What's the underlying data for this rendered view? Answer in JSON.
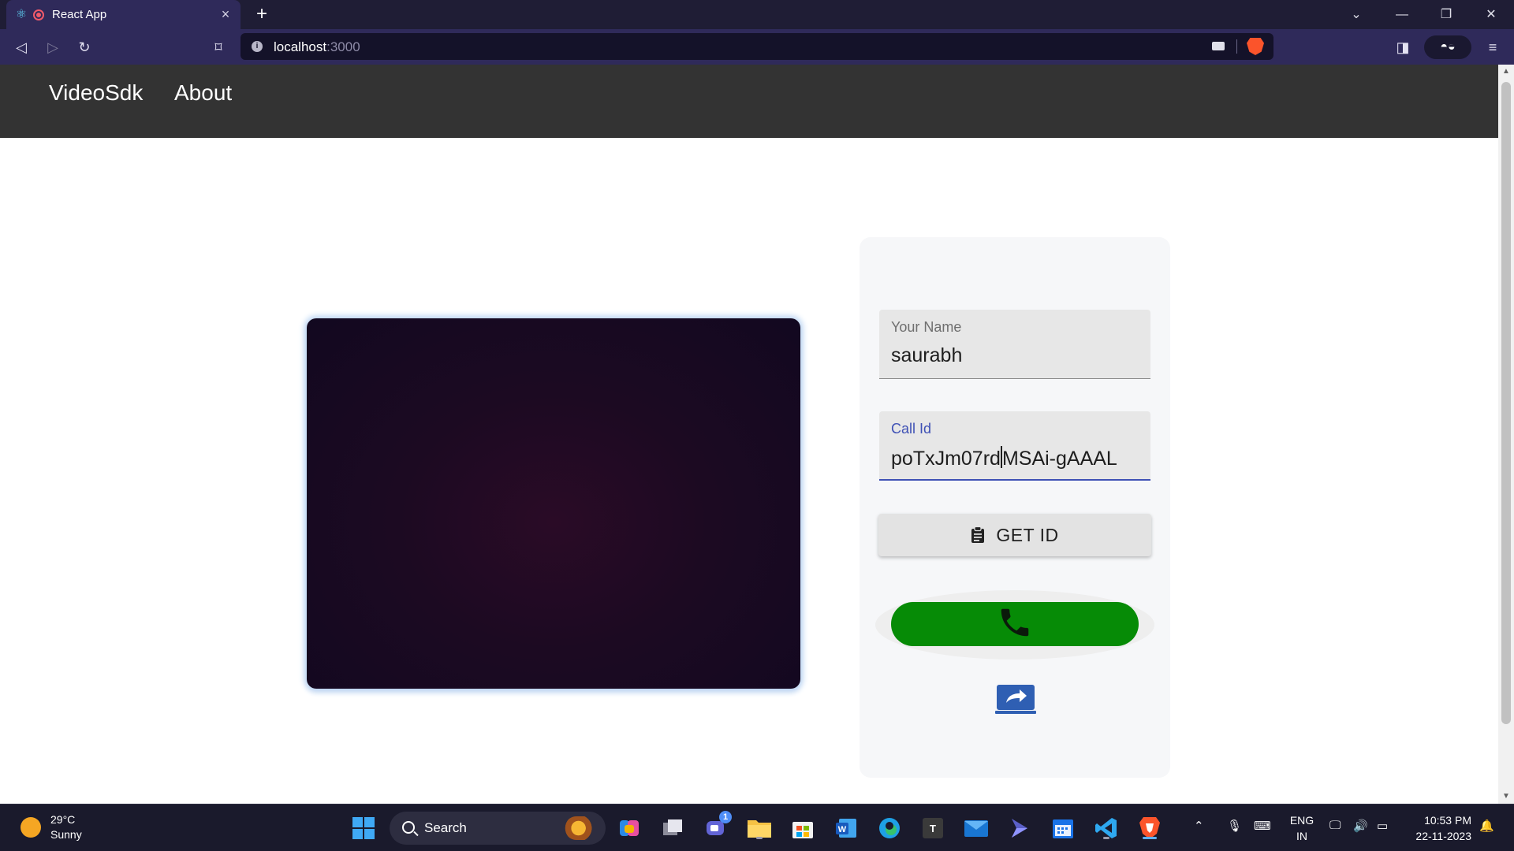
{
  "browser": {
    "tab_title": "React App",
    "tab_close": "×",
    "new_tab": "+",
    "url_host": "localhost",
    "url_port": ":3000",
    "window_controls": [
      "⌄",
      "—",
      "❐",
      "✕"
    ]
  },
  "nav": {
    "brand": "VideoSdk",
    "link_about": "About"
  },
  "form": {
    "name_label": "Your Name",
    "name_value": "saurabh",
    "callid_label": "Call Id",
    "callid_value_before_caret": "poTxJm07rd",
    "callid_value_after_caret": "MSAi-gAAAL",
    "get_id_label": "GET ID"
  },
  "colors": {
    "navbar": "#333333",
    "call_button": "#068b06",
    "share_button": "#2f5fb3",
    "focus_accent": "#3f51b5"
  },
  "taskbar": {
    "weather_temp": "29°C",
    "weather_desc": "Sunny",
    "search_text": "Search",
    "chat_badge": "1",
    "lang_line1": "ENG",
    "lang_line2": "IN",
    "time": "10:53 PM",
    "date": "22-11-2023",
    "apps": [
      "windows-start",
      "search",
      "copilot",
      "task-view",
      "teams",
      "file-explorer",
      "microsoft-store",
      "word",
      "edge",
      "typora",
      "mail",
      "power-automate",
      "calendar",
      "vscode",
      "brave"
    ]
  }
}
